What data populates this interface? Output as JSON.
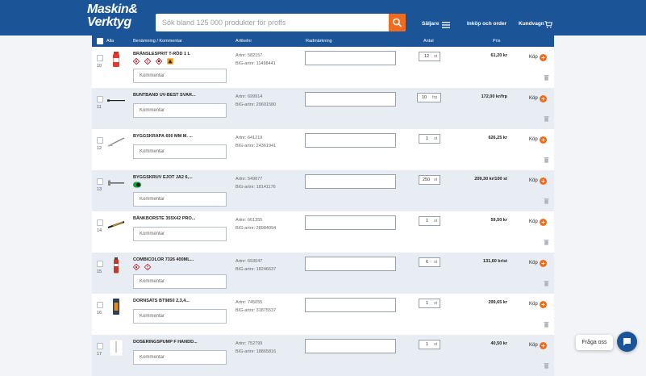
{
  "header": {
    "logo_line1": "Maskin&",
    "logo_line2": "Verktyg",
    "search_placeholder": "Sök bland 125 000 produkter för proffs",
    "nav_saljare": "Säljare",
    "nav_inkop": "Inköp och order",
    "nav_kundvagn": "Kundvagn"
  },
  "table": {
    "headers": {
      "all": "Alla",
      "name": "Benämning / Kommentar",
      "artnr": "Artikelnr",
      "radmarkning": "Radmärkning",
      "antal": "Antal",
      "pris": "Pris"
    },
    "comment_placeholder": "Kommentar",
    "buy_label": "Köp",
    "rows": [
      {
        "num": "10",
        "name": "BRÄNSLESPRIT T-RÖD 1 L",
        "artnr": "Artnr: 582157",
        "bignr": "BIG-artnr: 11498441",
        "qty": "12",
        "unit": "st",
        "price": "61,20 kr",
        "pictos": [
          "flame",
          "exclamation",
          "health",
          "orange"
        ]
      },
      {
        "num": "11",
        "name": "BUNTBAND UV-BEST SVAR...",
        "artnr": "Artnr: 699914",
        "bignr": "BIG-artnr: 29601580",
        "qty": "10",
        "unit": "frp",
        "price": "172,00 kr/frp",
        "pictos": []
      },
      {
        "num": "12",
        "name": "BYGGSKRAPA 600 MM M. ...",
        "artnr": "Artnr: 641219",
        "bignr": "BIG-artnr: 24361941",
        "qty": "1",
        "unit": "st",
        "price": "626,25 kr",
        "pictos": []
      },
      {
        "num": "13",
        "name": "BYGGSKRUV EJOT JA2 6,...",
        "artnr": "Artnr: 549877",
        "bignr": "BIG-artnr: 18141176",
        "qty": "250",
        "unit": "st",
        "price": "209,30 kr/100 st",
        "pictos": [
          "green"
        ]
      },
      {
        "num": "14",
        "name": "BÄNKBORSTE 355X42 PRO...",
        "artnr": "Artnr: 661355",
        "bignr": "BIG-artnr: 28984094",
        "qty": "1",
        "unit": "st",
        "price": "59,50 kr",
        "pictos": []
      },
      {
        "num": "15",
        "name": "COMBICOLOR 7326 400ML...",
        "artnr": "Artnr: 693047",
        "bignr": "BIG-artnr: 18246637",
        "qty": "6",
        "unit": "st",
        "price": "131,60 kr/st",
        "pictos": [
          "flame",
          "exclamation"
        ]
      },
      {
        "num": "16",
        "name": "DORNSATS BT9850 2,3,4...",
        "artnr": "Artnr: 745055",
        "bignr": "BIG-artnr: 31875537",
        "qty": "1",
        "unit": "st",
        "price": "299,65 kr",
        "pictos": []
      },
      {
        "num": "17",
        "name": "DOSERINGSPUMP F HANDD...",
        "artnr": "Artnr: 752799",
        "bignr": "BIG-artnr: 18865816",
        "qty": "1",
        "unit": "st",
        "price": "40,50 kr",
        "pictos": []
      }
    ]
  },
  "chat": {
    "label": "Fråga oss"
  },
  "colors": {
    "brand_blue": "#1b5597",
    "accent_orange": "#ef6c1e"
  }
}
